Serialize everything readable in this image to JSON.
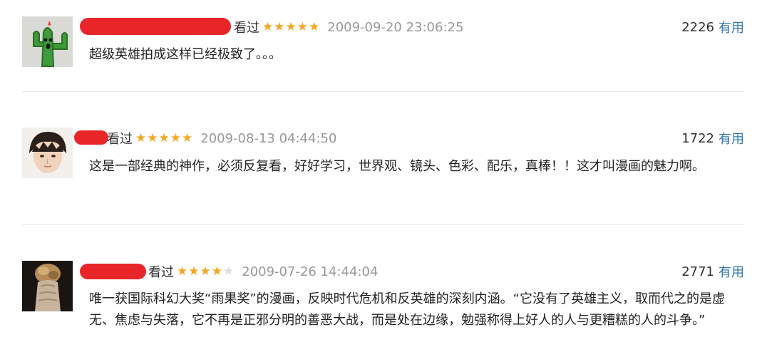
{
  "comments": [
    {
      "status": "看过",
      "rating": 5,
      "time": "2009-09-20 23:06:25",
      "votes": "2226",
      "useful_label": "有用",
      "content": "超级英雄拍成这样已经极致了。。。",
      "avatar_icon": "cactus-avatar-icon"
    },
    {
      "status": "看过",
      "rating": 5,
      "time": "2009-08-13 04:44:50",
      "votes": "1722",
      "useful_label": "有用",
      "content": "这是一部经典的神作，必须反复看，好好学习，世界观、镜头、色彩、配乐，真棒！！这才叫漫画的魅力啊。",
      "avatar_icon": "person-avatar-icon"
    },
    {
      "status": "看过",
      "rating": 4,
      "time": "2009-07-26 14:44:04",
      "votes": "2771",
      "useful_label": "有用",
      "content": "唯一获国际科幻大奖“雨果奖”的漫画，反映时代危机和反英雄的深刻内涵。“它没有了英雄主义，取而代之的是虚无、焦虑与失落，它不再是正邪分明的善恶大战，而是处在边缘，勉强称得上好人的人与更糟糕的人的斗争。”",
      "avatar_icon": "photo-avatar-icon"
    }
  ],
  "colors": {
    "star": "#f5a623",
    "star_empty": "#dddddd",
    "link": "#3377aa",
    "redaction": "#e8262a"
  }
}
